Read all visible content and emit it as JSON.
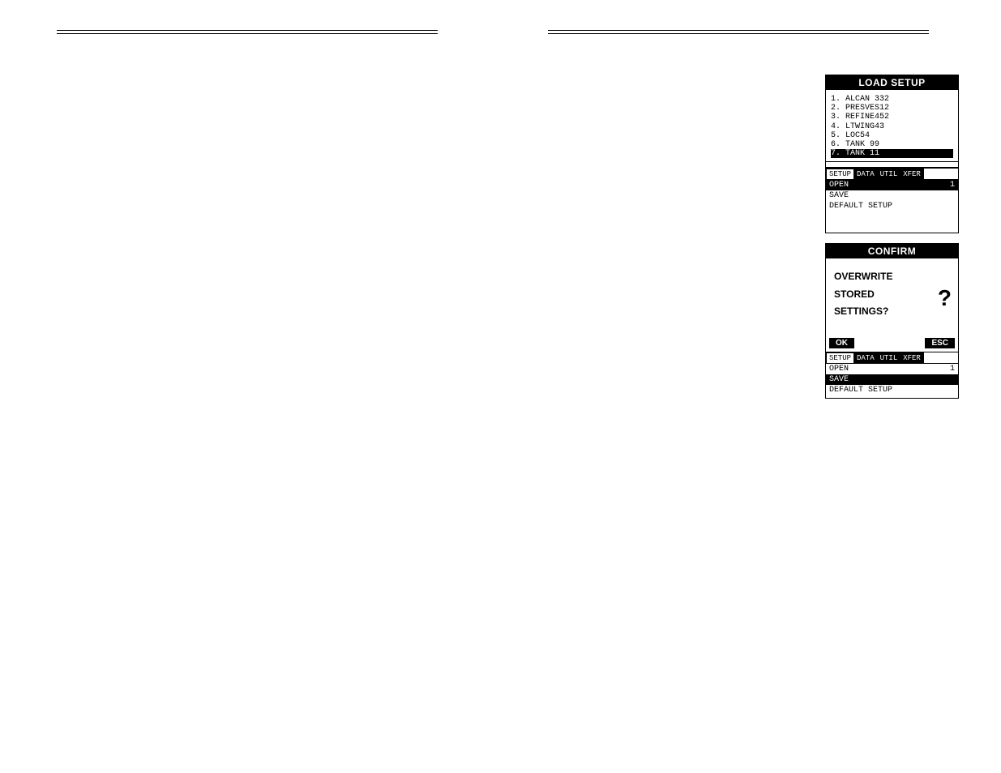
{
  "device1": {
    "title": "LOAD SETUP",
    "list": [
      {
        "n": "1.",
        "name": "ALCAN 332",
        "sel": false
      },
      {
        "n": "2.",
        "name": "PRESVES12",
        "sel": false
      },
      {
        "n": "3.",
        "name": "REFINE452",
        "sel": false
      },
      {
        "n": "4.",
        "name": "LTWING43",
        "sel": false
      },
      {
        "n": "5.",
        "name": "LOC54",
        "sel": false
      },
      {
        "n": "6.",
        "name": "TANK 99",
        "sel": false
      },
      {
        "n": "7.",
        "name": "TANK 11",
        "sel": true
      }
    ],
    "tabs": [
      "SETUP",
      "DATA",
      "UTIL",
      "XFER"
    ],
    "activeTab": 0,
    "menu": [
      {
        "label": "OPEN",
        "right": "1",
        "sel": true
      },
      {
        "label": "SAVE",
        "right": "",
        "sel": false
      },
      {
        "label": "DEFAULT SETUP",
        "right": "",
        "sel": false
      }
    ]
  },
  "device2": {
    "title": "CONFIRM",
    "lines": [
      "OVERWRITE",
      "STORED",
      "SETTINGS?"
    ],
    "qmark": "?",
    "buttons": {
      "ok": "OK",
      "esc": "ESC"
    },
    "tabs": [
      "SETUP",
      "DATA",
      "UTIL",
      "XFER"
    ],
    "activeTab": 0,
    "menu": [
      {
        "label": "OPEN",
        "right": "1",
        "sel": false
      },
      {
        "label": "SAVE",
        "right": "",
        "sel": true
      },
      {
        "label": "DEFAULT SETUP",
        "right": "",
        "sel": false
      }
    ]
  }
}
